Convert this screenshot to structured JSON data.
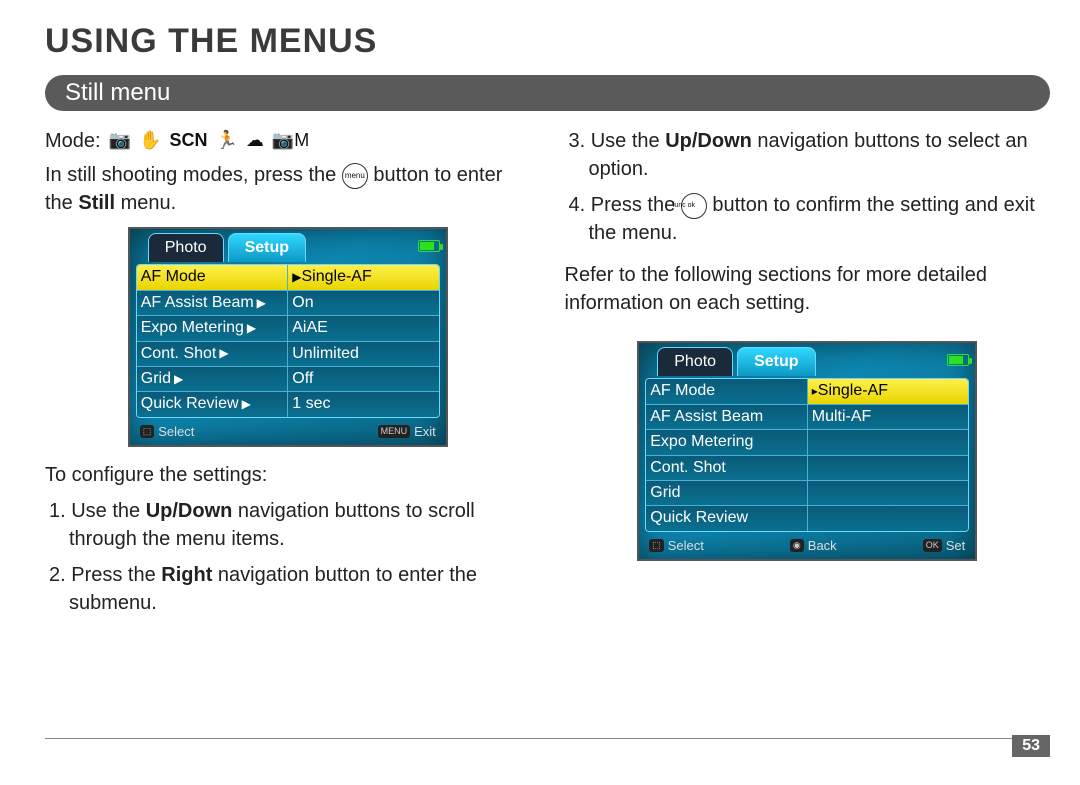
{
  "chapter_title": "USING THE MENUS",
  "section_title": "Still menu",
  "left": {
    "mode_label": "Mode:",
    "mode_icons": [
      "📷",
      "✋",
      "SCN",
      "🏃",
      "☁",
      "📷M"
    ],
    "intro_a": "In still shooting modes, press the ",
    "intro_btn": "menu",
    "intro_b": " button to enter the ",
    "intro_bold": "Still",
    "intro_c": " menu.",
    "configure": "To configure the settings:",
    "step1_a": "1. Use the ",
    "step1_bold": "Up/Down",
    "step1_b": " navigation buttons to scroll through the menu items.",
    "step2_a": "2. Press the ",
    "step2_bold": "Right",
    "step2_b": " navigation button to enter the submenu."
  },
  "right": {
    "step3_a": "3. Use the ",
    "step3_bold": "Up/Down",
    "step3_b": " navigation buttons to select an option.",
    "step4_a": "4. Press the ",
    "step4_btn": "func ok",
    "step4_b": " button to confirm the setting and exit the menu.",
    "refer": "Refer to the following sections for more de­tailed information on each setting."
  },
  "screen1": {
    "tab_photo": "Photo",
    "tab_setup": "Setup",
    "rows": [
      {
        "label": "AF Mode",
        "value": "Single-AF",
        "hl": true,
        "arrow": true
      },
      {
        "label": "AF Assist Beam",
        "value": "On"
      },
      {
        "label": "Expo Metering",
        "value": "AiAE"
      },
      {
        "label": "Cont. Shot",
        "value": "Unlimited"
      },
      {
        "label": "Grid",
        "value": "Off"
      },
      {
        "label": "Quick Review",
        "value": "1 sec"
      }
    ],
    "footer_left": "Select",
    "footer_right": "Exit",
    "footer_left_key": "⬚",
    "footer_right_key": "MENU"
  },
  "screen2": {
    "tab_photo": "Photo",
    "tab_setup": "Setup",
    "rows": [
      {
        "label": "AF Mode",
        "value": "Single-AF",
        "hl_right": true
      },
      {
        "label": "AF Assist Beam",
        "value": "Multi-AF"
      },
      {
        "label": "Expo Metering",
        "value": ""
      },
      {
        "label": "Cont. Shot",
        "value": ""
      },
      {
        "label": "Grid",
        "value": ""
      },
      {
        "label": "Quick Review",
        "value": ""
      }
    ],
    "footer_left": "Select",
    "footer_mid": "Back",
    "footer_right": "Set",
    "footer_left_key": "⬚",
    "footer_mid_key": "◉",
    "footer_right_key": "OK"
  },
  "page_number": "53"
}
